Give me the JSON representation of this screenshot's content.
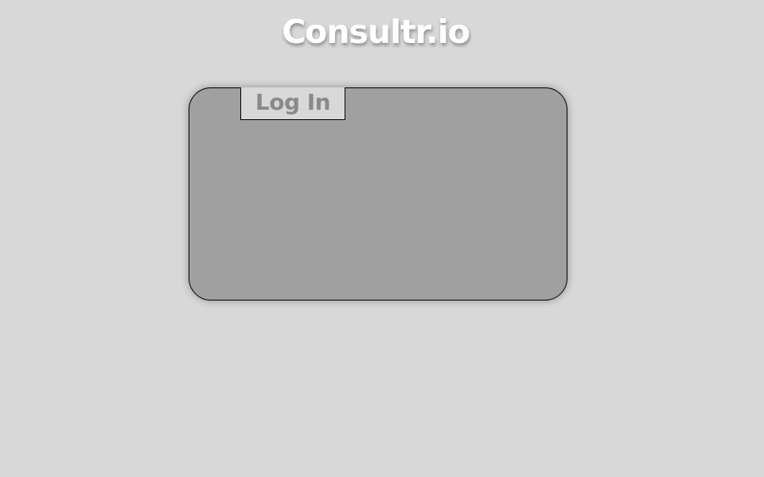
{
  "header": {
    "brand": "Consultr.io"
  },
  "login_panel": {
    "tab_label": "Log In"
  },
  "colors": {
    "page_background": "#d8d8d8",
    "panel_background": "#a0a0a0",
    "brand_text": "#ffffff",
    "tab_text": "#8a8a8a"
  }
}
